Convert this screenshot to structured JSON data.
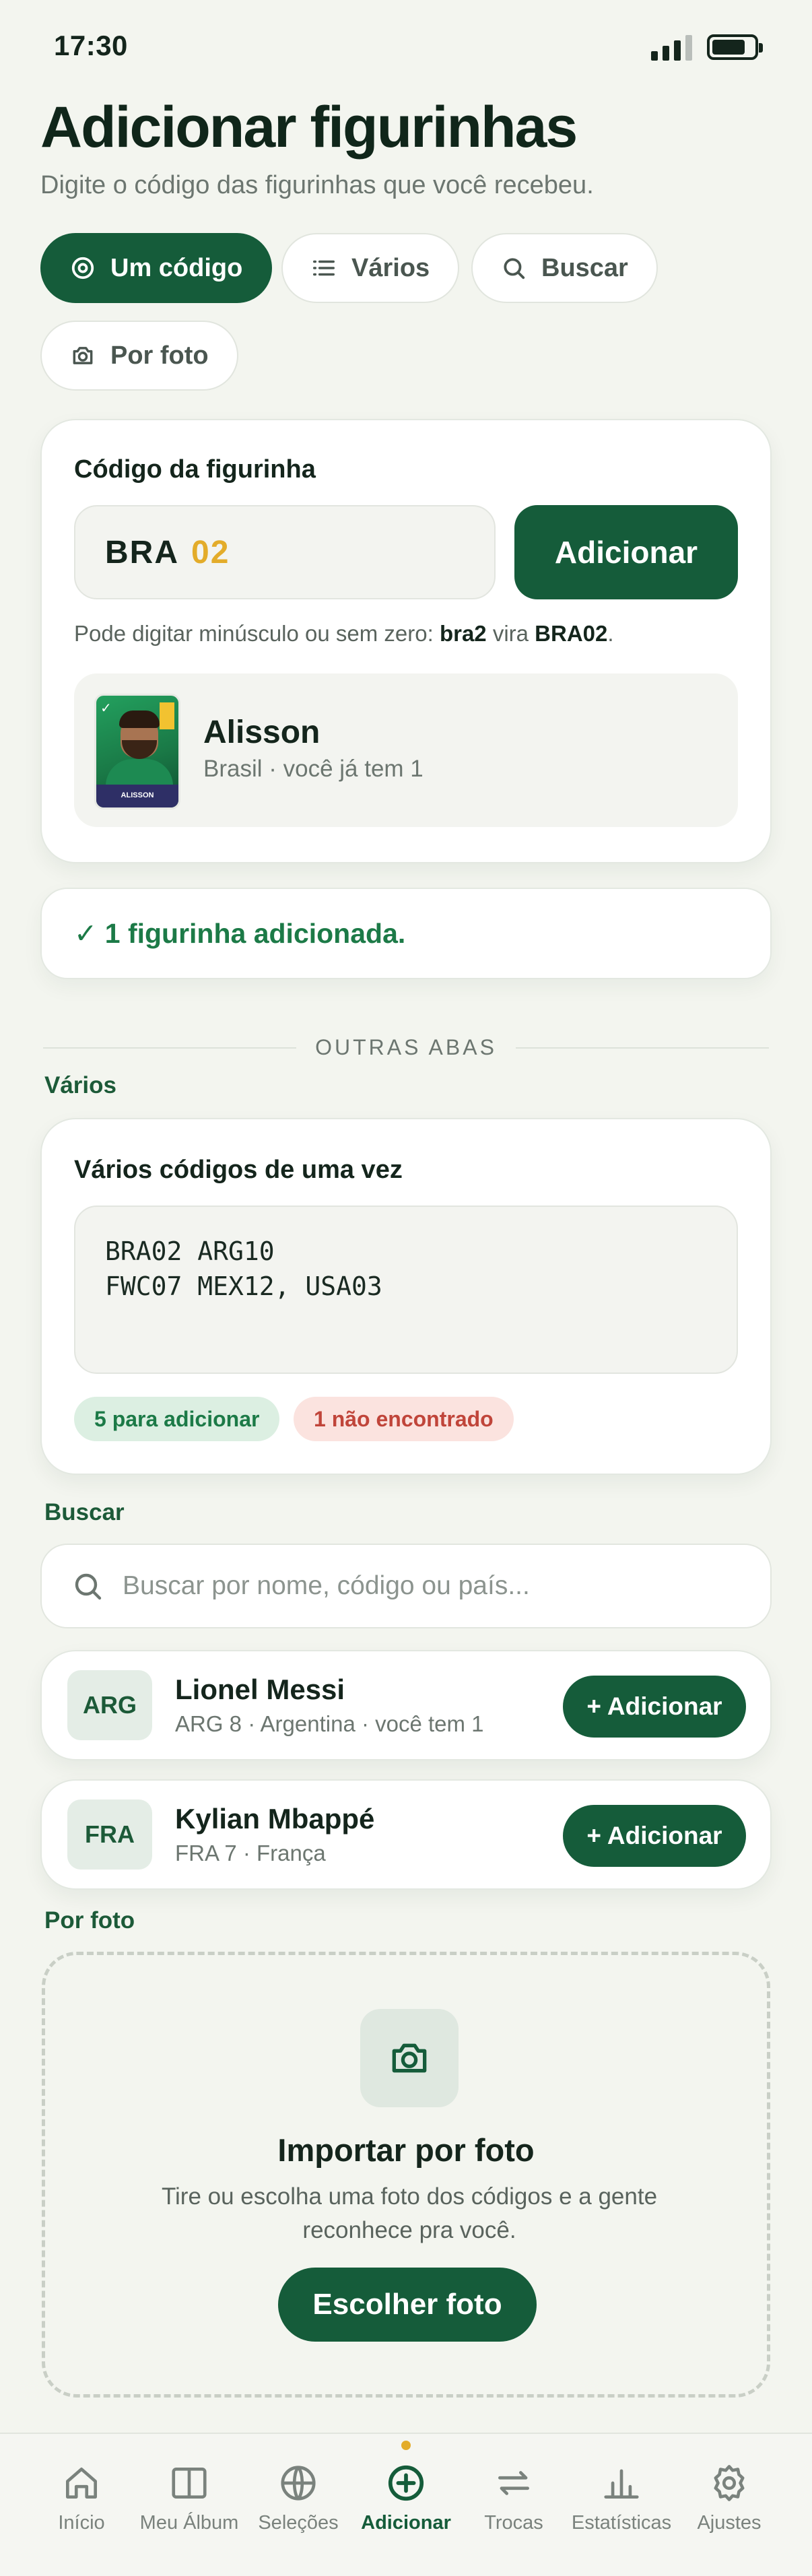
{
  "status_bar": {
    "time": "17:30"
  },
  "header": {
    "title": "Adicionar figurinhas",
    "subtitle": "Digite o código das figurinhas que você recebeu."
  },
  "tabs": [
    {
      "label": "Um código",
      "icon": "target-icon",
      "active": true
    },
    {
      "label": "Vários",
      "icon": "list-icon",
      "active": false
    },
    {
      "label": "Buscar",
      "icon": "search-icon",
      "active": false
    },
    {
      "label": "Por foto",
      "icon": "camera-icon",
      "active": false
    }
  ],
  "single_code": {
    "label": "Código da figurinha",
    "code_prefix": "BRA",
    "code_number": "02",
    "add_button": "Adicionar",
    "hint_prefix": "Pode digitar minúsculo ou sem zero: ",
    "hint_example": "bra2",
    "hint_middle": " vira ",
    "hint_result": "BRA02",
    "hint_suffix": ".",
    "result": {
      "sticker_name": "ALISSON",
      "name": "Alisson",
      "subtitle": "Brasil · você já tem 1"
    }
  },
  "success_message": "✓ 1 figurinha adicionada.",
  "divider_label": "OUTRAS ABAS",
  "multi": {
    "section": "Vários",
    "label": "Vários códigos de uma vez",
    "textarea_value": "BRA02 ARG10\nFWC07 MEX12, USA03",
    "ok_pill": "5 para adicionar",
    "err_pill": "1 não encontrado"
  },
  "search": {
    "section": "Buscar",
    "placeholder": "Buscar por nome, código ou país...",
    "results": [
      {
        "badge": "ARG",
        "name": "Lionel Messi",
        "subtitle": "ARG 8 · Argentina · você tem 1",
        "button": "+ Adicionar"
      },
      {
        "badge": "FRA",
        "name": "Kylian Mbappé",
        "subtitle": "FRA 7 · França",
        "button": "+ Adicionar"
      }
    ]
  },
  "photo": {
    "section": "Por foto",
    "title": "Importar por foto",
    "description": "Tire ou escolha uma foto dos códigos e a gente reconhece pra você.",
    "button": "Escolher foto"
  },
  "bottom_nav": [
    {
      "label": "Início",
      "icon": "home-icon",
      "active": false
    },
    {
      "label": "Meu Álbum",
      "icon": "album-icon",
      "active": false
    },
    {
      "label": "Seleções",
      "icon": "globe-icon",
      "active": false
    },
    {
      "label": "Adicionar",
      "icon": "plus-circle-icon",
      "active": true
    },
    {
      "label": "Trocas",
      "icon": "swap-icon",
      "active": false
    },
    {
      "label": "Estatísticas",
      "icon": "bar-chart-icon",
      "active": false
    },
    {
      "label": "Ajustes",
      "icon": "gear-icon",
      "active": false
    }
  ],
  "colors": {
    "primary": "#155c3a",
    "accent": "#e3ac2a",
    "background": "#f3f5ef",
    "success_text": "#1c7a47",
    "error_text": "#c0453a"
  }
}
